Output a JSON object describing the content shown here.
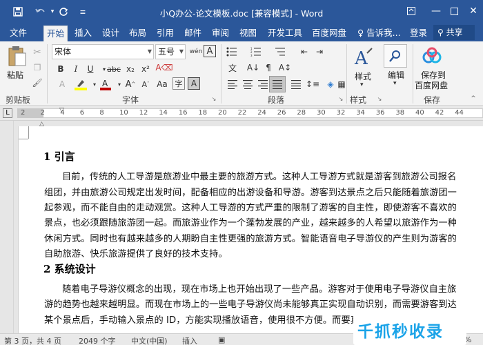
{
  "titlebar": {
    "title": "小Q办公-论文模板.doc [兼容模式] - Word",
    "save_icon": "save-icon",
    "undo_icon": "undo-icon",
    "redo_icon": "redo-icon",
    "customize_icon": "customize-icon"
  },
  "tabs": [
    "文件",
    "开始",
    "插入",
    "设计",
    "布局",
    "引用",
    "邮件",
    "审阅",
    "视图",
    "开发工具",
    "百度网盘",
    "告诉我..."
  ],
  "tabs_extra": {
    "login": "登录",
    "share": "共享"
  },
  "ribbon": {
    "clipboard": {
      "paste": "粘贴",
      "label": "剪贴板"
    },
    "font": {
      "font_name": "宋体",
      "font_size": "五号",
      "label": "字体",
      "bold": "B",
      "italic": "I",
      "underline": "U",
      "strike": "abc",
      "sub": "x₂",
      "sup": "x²"
    },
    "paragraph": {
      "label": "段落"
    },
    "styles": {
      "button": "样式",
      "label": "样式"
    },
    "editing": {
      "button": "编辑"
    },
    "save": {
      "button_line1": "保存到",
      "button_line2": "百度网盘",
      "label": "保存"
    }
  },
  "ruler": {
    "ticks": [
      "2",
      "2",
      "4",
      "6",
      "8",
      "10",
      "12",
      "14",
      "16",
      "18",
      "20",
      "22",
      "24",
      "26",
      "28",
      "30",
      "32",
      "34",
      "36",
      "38",
      "40",
      "42",
      "44"
    ]
  },
  "document": {
    "heading1": "1  引言",
    "para1": [
      "目前，传统的人工导游是旅游业中最主要的旅游方式。这种人工导游方式就是游客到旅游公司报名",
      "组团，并由旅游公司规定出发时间，配备相应的出游设备和导游。游客到达景点之后只能随着旅游团一",
      "起参观，而不能自由的走动观赏。这种人工导游的方式严重的限制了游客的自主性，即使游客不喜欢的",
      "景点，也必须跟随旅游团一起。而旅游业作为一个蓬勃发展的产业，越来越多的人希望以旅游作为一种",
      "休闲方式。同时也有越来越多的人期盼自主性更强的旅游方式。智能语音电子导游仪的产生则为游客的",
      "自助旅游、快乐旅游提供了良好的技术支持。"
    ],
    "heading2": "2  系统设计",
    "para2": [
      "随着电子导游仪概念的出现，现在市场上也开始出现了一些产品。游客对于使用电子导游仪自主旅",
      "游的趋势也越来越明显。而现在市场上的一些电子导游仪尚未能够真正实现自动识别，而需要游客到达",
      "某个景点后，手动输入景点的 ID，方能实现播放语音，使用很不方便。而要真正的实现自助旅游、环"
    ]
  },
  "statusbar": {
    "page": "第 3 页，共 4 页",
    "words": "2049 个字",
    "language": "中文(中国)",
    "mode": "插入",
    "zoom": "100%"
  },
  "watermark": {
    "text": "千抓秒收录"
  },
  "colors": {
    "brand": "#2b579a",
    "highlight": "#ffff00",
    "font_color": "#c00000"
  }
}
